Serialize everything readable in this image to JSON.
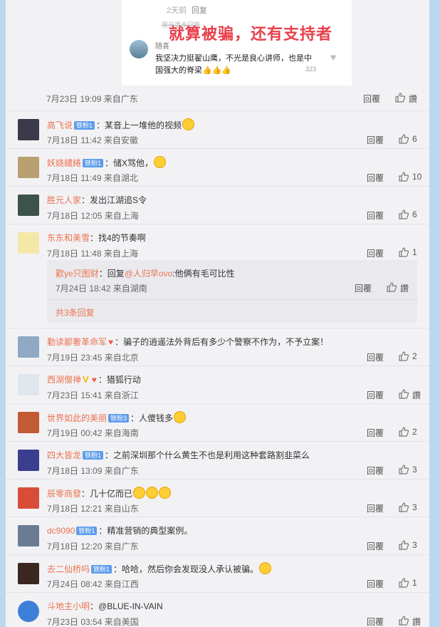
{
  "top_post": {
    "embed": {
      "time_hint": "2天前",
      "reply_hint": "回复",
      "struck_text": "展开更多回复",
      "overlay": "就算被骗，还有支持者",
      "commenter": "随喜",
      "text_line1": "我坚决力挺翟山鹰，不光是良心讲师，也是中",
      "text_line2": "国强大的脊梁👍👍👍",
      "like_count": "323"
    },
    "meta": "7月23日 19:09 来自广东",
    "reply_label": "回覆",
    "like_label": "讚"
  },
  "comments": [
    {
      "name": "高飞说",
      "badge": "铁粉1",
      "text": "：某音上一堆他的视频",
      "emoji": true,
      "meta": "7月18日 11:42 来自安徽",
      "reply": "回覆",
      "likes": "6",
      "avatar": "#3a3a4a"
    },
    {
      "name": "妖娆繾綣",
      "badge": "铁粉1",
      "text": "：储X骂他，",
      "emoji": true,
      "meta": "7月18日 11:49 来自湖北",
      "reply": "回覆",
      "likes": "10",
      "avatar": "#b8a070"
    },
    {
      "name": "胜元人家",
      "text": "：发出江湖追S令",
      "meta": "7月18日 12:05 来自上海",
      "reply": "回覆",
      "likes": "6",
      "avatar": "#3d5248"
    },
    {
      "name": "东东和美雪",
      "text": "：找4的节奏啊",
      "meta": "7月18日 11:48 来自上海",
      "reply": "回覆",
      "likes": "1",
      "avatar": "#f4e8a8"
    },
    {
      "name": "勤读鄙奢革命军",
      "heart": true,
      "text": "：骗子的逍遥法外背后有多少个警察不作为，不予立案！",
      "meta": "7月19日 23:45 来自北京",
      "reply": "回覆",
      "likes": "2",
      "avatar": "#8fa9c4"
    },
    {
      "name": "西湖僧禅",
      "vmark": "V",
      "heart": true,
      "text": "：猎狐行动",
      "meta": "7月23日 15:41 来自浙江",
      "reply": "回覆",
      "likes": "讚",
      "avatar": "#dfe6ee"
    },
    {
      "name": "世界如此的美丽",
      "badge": "铁粉3",
      "text": "：人傻钱多",
      "emoji": true,
      "meta": "7月19日 00:42 来自海南",
      "reply": "回覆",
      "likes": "2",
      "avatar": "#c35a33"
    },
    {
      "name": "四大皆龙",
      "badge": "铁粉1",
      "text": "：之前深圳那个什么黄生不也是利用这种套路割韭菜么",
      "meta": "7月18日 13:09 来自广东",
      "reply": "回覆",
      "likes": "3",
      "avatar": "#3b3e8e"
    },
    {
      "name": "辰零商發",
      "text": "：几十亿而已",
      "emoji": true,
      "emoji_count": 3,
      "meta": "7月18日 12:21 来自山东",
      "reply": "回覆",
      "likes": "3",
      "avatar": "#d84d3a"
    },
    {
      "name": "dc9090",
      "badge": "铁粉1",
      "text": "：精准营销的典型案例。",
      "meta": "7月18日 12:20 来自广东",
      "reply": "回覆",
      "likes": "3",
      "avatar": "#6b7b93"
    },
    {
      "name": "去二仙桥吗",
      "badge": "铁粉1",
      "text": "：哈哈，然后你会发现没人承认被骗。",
      "emoji": true,
      "meta": "7月24日 08:42 来自江西",
      "reply": "回覆",
      "likes": "1",
      "avatar": "#3a2820"
    },
    {
      "name": "斗地主小明",
      "text": "：@BLUE-IN-VAIN",
      "meta": "7月23日 03:54 来自美国",
      "reply": "回覆",
      "likes": "讚",
      "avatar": "#3d7fd6"
    }
  ],
  "sub_reply": {
    "name": "歡ye只图财",
    "prefix": "：回复",
    "mention": "@人归早ovo",
    "text": ":他俩有毛可比性",
    "meta": "7月24日 18:42 来自湖南",
    "reply": "回覆",
    "like": "讚",
    "more": "共3条回复"
  },
  "colors": {
    "name": "#eb7350",
    "badge": "#5d9cec",
    "background": "#f2f2f5",
    "side": "#bcd8ef"
  }
}
